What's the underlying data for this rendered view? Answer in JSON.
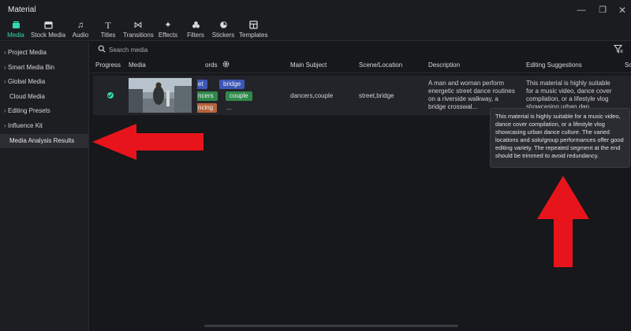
{
  "app": {
    "title": "Material"
  },
  "window_controls": {
    "minimize": "—",
    "maximize": "❐",
    "close": "✕"
  },
  "toolbar": {
    "items": [
      {
        "label": "Media",
        "icon": "media-icon",
        "active": true
      },
      {
        "label": "Stock Media",
        "icon": "stock-media-icon"
      },
      {
        "label": "Audio",
        "icon": "music-note-icon"
      },
      {
        "label": "Titles",
        "icon": "text-t-icon"
      },
      {
        "label": "Transitions",
        "icon": "transition-bowtie-icon"
      },
      {
        "label": "Effects",
        "icon": "sparkle-icon"
      },
      {
        "label": "Filters",
        "icon": "filter-circles-icon"
      },
      {
        "label": "Stickers",
        "icon": "sticker-icon"
      },
      {
        "label": "Templates",
        "icon": "template-icon"
      }
    ]
  },
  "sidebar": {
    "items": [
      {
        "label": "Project Media",
        "expandable": true
      },
      {
        "label": "Smart Media Bin",
        "expandable": true
      },
      {
        "label": "Global Media",
        "expandable": true
      },
      {
        "label": "Cloud Media",
        "expandable": false
      },
      {
        "label": "Editing Presets",
        "expandable": true
      },
      {
        "label": "Influence Kit",
        "expandable": true
      },
      {
        "label": "Media Analysis Results",
        "expandable": false,
        "selected": true
      }
    ]
  },
  "search": {
    "placeholder": "Search media"
  },
  "table": {
    "columns": [
      "Progress",
      "Media",
      "ords",
      "Main Subject",
      "Scene/Location",
      "Description",
      "Editing Suggestions",
      "Sc"
    ],
    "row": {
      "status": "complete",
      "keyword_tags": [
        {
          "text": "et",
          "color": "#3d56b8"
        },
        {
          "text": "bridge",
          "color": "#3d56b8"
        },
        {
          "text": "ncers",
          "color": "#2f8a4a"
        },
        {
          "text": "couple",
          "color": "#2f8a4a"
        },
        {
          "text": "ncing",
          "color": "#b5643a"
        },
        {
          "text": "...",
          "color": ""
        }
      ],
      "main_subject": "dancers,couple",
      "scene_location": "street,bridge",
      "description": "A man and woman perform energetic street dance routines on a riverside walkway, a bridge crosswal...",
      "editing_suggestions": "This material is highly suitable for a music video, dance cover compilation, or a lifestyle vlog showcasing urban dan..."
    }
  },
  "tooltip": {
    "text": "This material is highly suitable for a music video, dance cover compilation, or a lifestyle vlog showcasing urban dance culture. The varied locations and solo/group performances offer good editing variety. The repeated segment at the end should be trimmed to avoid redundancy."
  },
  "colors": {
    "accent": "#35d7b2",
    "annotation_arrow": "#e8141c"
  }
}
